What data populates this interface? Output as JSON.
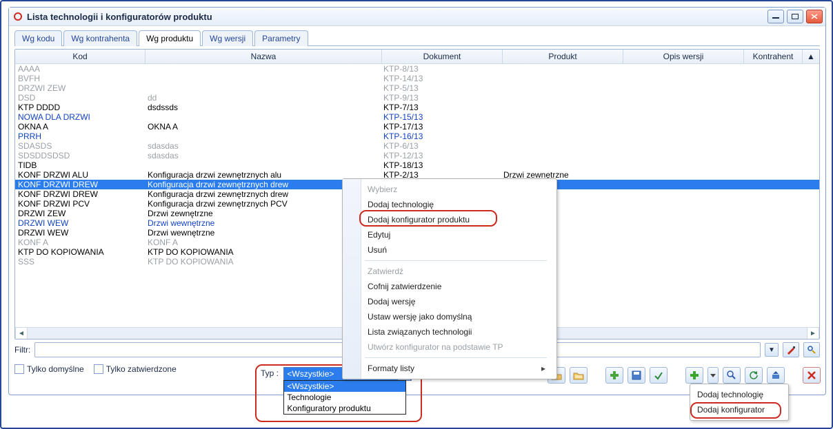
{
  "window": {
    "title": "Lista technologii i konfiguratorów produktu"
  },
  "tabs": [
    {
      "label": "Wg kodu"
    },
    {
      "label": "Wg kontrahenta"
    },
    {
      "label": "Wg produktu",
      "active": true
    },
    {
      "label": "Wg wersji"
    },
    {
      "label": "Parametry"
    }
  ],
  "columns": {
    "kod": "Kod",
    "nazwa": "Nazwa",
    "dokument": "Dokument",
    "produkt": "Produkt",
    "opis": "Opis wersji",
    "kontrahent": "Kontrahent"
  },
  "rows": [
    {
      "style": "gray",
      "kod": "AAAA",
      "nazwa": "",
      "dokument": "KTP-8/13",
      "produkt": ""
    },
    {
      "style": "gray",
      "kod": "BVFH",
      "nazwa": "",
      "dokument": "KTP-14/13",
      "produkt": ""
    },
    {
      "style": "gray",
      "kod": "DRZWI ZEW",
      "nazwa": "",
      "dokument": "KTP-5/13",
      "produkt": ""
    },
    {
      "style": "gray",
      "kod": "DSD",
      "nazwa": "dd",
      "dokument": "KTP-9/13",
      "produkt": ""
    },
    {
      "style": "",
      "kod": "KTP DDDD",
      "nazwa": "dsdssds",
      "dokument": "KTP-7/13",
      "produkt": ""
    },
    {
      "style": "blue",
      "kod": "NOWA DLA DRZWI",
      "nazwa": "",
      "dokument": "KTP-15/13",
      "produkt": ""
    },
    {
      "style": "",
      "kod": "OKNA A",
      "nazwa": "OKNA A",
      "dokument": "KTP-17/13",
      "produkt": ""
    },
    {
      "style": "blue",
      "kod": "PRRH",
      "nazwa": "",
      "dokument": "KTP-16/13",
      "produkt": ""
    },
    {
      "style": "gray",
      "kod": "SDASDS",
      "nazwa": "sdasdas",
      "dokument": "KTP-6/13",
      "produkt": ""
    },
    {
      "style": "gray",
      "kod": "SDSDDSDSD",
      "nazwa": "sdasdas",
      "dokument": "KTP-12/13",
      "produkt": ""
    },
    {
      "style": "",
      "kod": "TIDB",
      "nazwa": "",
      "dokument": "KTP-18/13",
      "produkt": ""
    },
    {
      "style": "",
      "kod": "KONF DRZWI ALU",
      "nazwa": "Konfiguracja drzwi zewnętrznych alu",
      "dokument": "KTP-2/13",
      "produkt": "Drzwi zewnętrzne"
    },
    {
      "style": "sel",
      "kod": "KONF DRZWI DREW",
      "nazwa": "Konfiguracja drzwi zewnętrznych drew",
      "dokument": "",
      "produkt": "rzne"
    },
    {
      "style": "",
      "kod": "KONF DRZWI DREW",
      "nazwa": "Konfiguracja drzwi zewnętrznych drew",
      "dokument": "",
      "produkt": "rzne"
    },
    {
      "style": "",
      "kod": "KONF DRZWI PCV",
      "nazwa": "Konfiguracja drzwi zewnętrznych PCV",
      "dokument": "",
      "produkt": "rzne"
    },
    {
      "style": "",
      "kod": "DRZWI ZEW",
      "nazwa": "Drzwi zewnętrzne",
      "dokument": "",
      "produkt": "rzne Olch"
    },
    {
      "style": "blue",
      "kod": "DRZWI WEW",
      "nazwa": "Drzwi wewnętrzne",
      "dokument": "",
      "produkt": "rzne Retr"
    },
    {
      "style": "",
      "kod": "DRZWI WEW",
      "nazwa": "Drzwi wewnętrzne",
      "dokument": "",
      "produkt": "rzne Retr"
    },
    {
      "style": "gray",
      "kod": "KONF A",
      "nazwa": "KONF A",
      "dokument": "",
      "produkt": ""
    },
    {
      "style": "",
      "kod": "KTP DO KOPIOWANIA",
      "nazwa": "KTP DO KOPIOWANIA",
      "dokument": "",
      "produkt": ""
    },
    {
      "style": "gray",
      "kod": "SSS",
      "nazwa": "KTP DO KOPIOWANIA",
      "dokument": "",
      "produkt": ""
    }
  ],
  "filter": {
    "label": "Filtr:",
    "value": "",
    "placeholder": ""
  },
  "checkboxes": {
    "only_default": "Tylko domyślne",
    "only_approved": "Tylko zatwierdzone"
  },
  "type_combo": {
    "label": "Typ :",
    "selected": "<Wszystkie>",
    "options": [
      "<Wszystkie>",
      "Technologie",
      "Konfiguratory produktu"
    ]
  },
  "context_menu": {
    "items": [
      {
        "label": "Wybierz",
        "disabled": true
      },
      {
        "label": "Dodaj technologię"
      },
      {
        "label": "Dodaj konfigurator produktu",
        "highlight": true
      },
      {
        "label": "Edytuj"
      },
      {
        "label": "Usuń"
      },
      {
        "sep": true
      },
      {
        "label": "Zatwierdź",
        "disabled": true
      },
      {
        "label": "Cofnij zatwierdzenie"
      },
      {
        "label": "Dodaj wersję"
      },
      {
        "label": "Ustaw wersję jako domyślną"
      },
      {
        "label": "Lista związanych technologii"
      },
      {
        "label": "Utwórz konfigurator na podstawie TP",
        "disabled": true
      },
      {
        "sep": true
      },
      {
        "label": "Formaty listy",
        "arrow": true
      }
    ]
  },
  "popup_menu": {
    "items": [
      {
        "label": "Dodaj technologię"
      },
      {
        "label": "Dodaj konfigurator",
        "highlight": true
      }
    ]
  }
}
